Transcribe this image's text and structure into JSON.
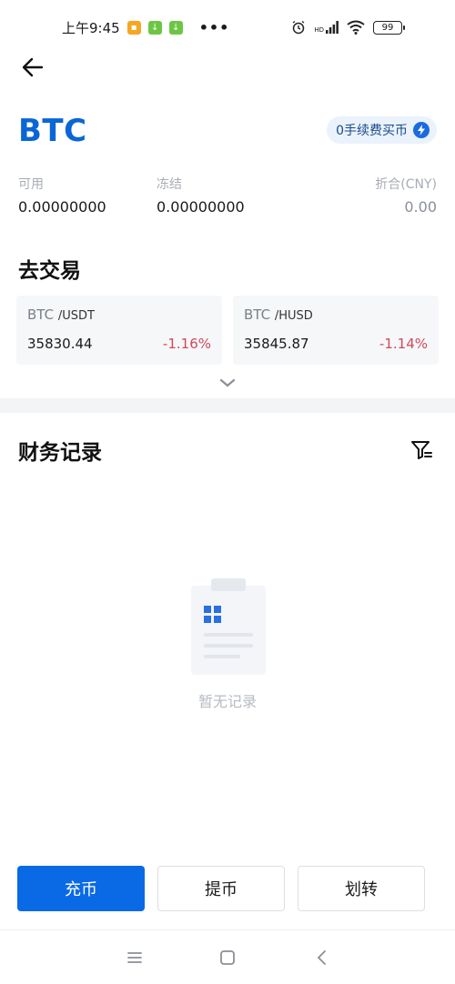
{
  "status_bar": {
    "time": "上午9:45",
    "dots": "•••",
    "hd": "HD",
    "battery": "99"
  },
  "header": {
    "coin": "BTC",
    "zero_fee_label": "0手续费买币"
  },
  "balances": {
    "available_label": "可用",
    "available_value": "0.00000000",
    "frozen_label": "冻结",
    "frozen_value": "0.00000000",
    "converted_label": "折合(CNY)",
    "converted_value": "0.00"
  },
  "trade": {
    "title": "去交易",
    "pairs": [
      {
        "base": "BTC",
        "quote": "/USDT",
        "price": "35830.44",
        "change": "-1.16%"
      },
      {
        "base": "BTC",
        "quote": "/HUSD",
        "price": "35845.87",
        "change": "-1.14%"
      }
    ]
  },
  "records": {
    "title": "财务记录",
    "empty_text": "暂无记录"
  },
  "actions": {
    "deposit": "充币",
    "withdraw": "提币",
    "transfer": "划转"
  },
  "colors": {
    "brand_blue": "#0a66d6",
    "negative": "#d04a5a",
    "muted": "#a8adb4"
  }
}
